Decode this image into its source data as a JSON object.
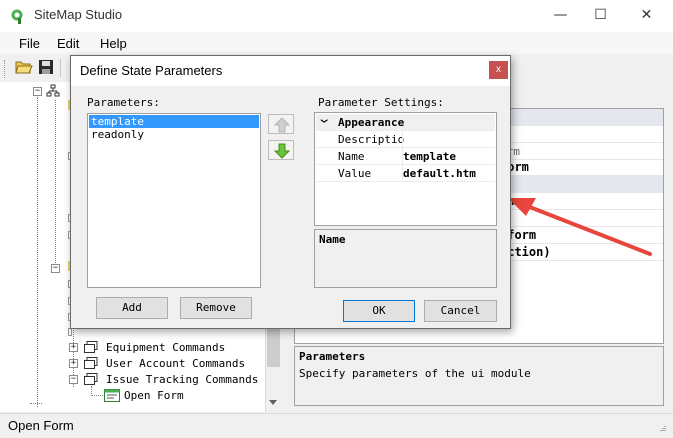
{
  "window": {
    "title": "SiteMap Studio",
    "minimize": "—",
    "maximize": "☐",
    "close": "✕"
  },
  "menu": [
    "File",
    "Edit",
    "Help"
  ],
  "tree": {
    "items": [
      {
        "label": "Equipment Commands"
      },
      {
        "label": "User Account Commands"
      },
      {
        "label": "Issue Tracking Commands"
      },
      {
        "label": "Open Form"
      }
    ]
  },
  "properties": {
    "partial_rows": [
      "orm",
      "Form",
      "ance",
      "lform",
      "ection)"
    ]
  },
  "description": {
    "title": "Parameters",
    "text": "Specify parameters of the ui module"
  },
  "status": {
    "text": "Open Form"
  },
  "dialog": {
    "title": "Define State Parameters",
    "close": "x",
    "parameters_label": "Parameters:",
    "parameters": [
      {
        "name": "template",
        "selected": true
      },
      {
        "name": "readonly",
        "selected": false
      }
    ],
    "settings_label": "Parameter Settings:",
    "category": "Appearance",
    "category_toggle": "❯",
    "settings": [
      {
        "key": "Descriptio",
        "value": ""
      },
      {
        "key": "Name",
        "value": "template"
      },
      {
        "key": "Value",
        "value": "default.htm"
      }
    ],
    "settings_desc_title": "Name",
    "buttons": {
      "add": "Add",
      "remove": "Remove",
      "ok": "OK",
      "cancel": "Cancel"
    }
  },
  "colors": {
    "selection": "#3399ff",
    "close_button": "#c75050",
    "annotation_arrow": "#e8453c"
  }
}
